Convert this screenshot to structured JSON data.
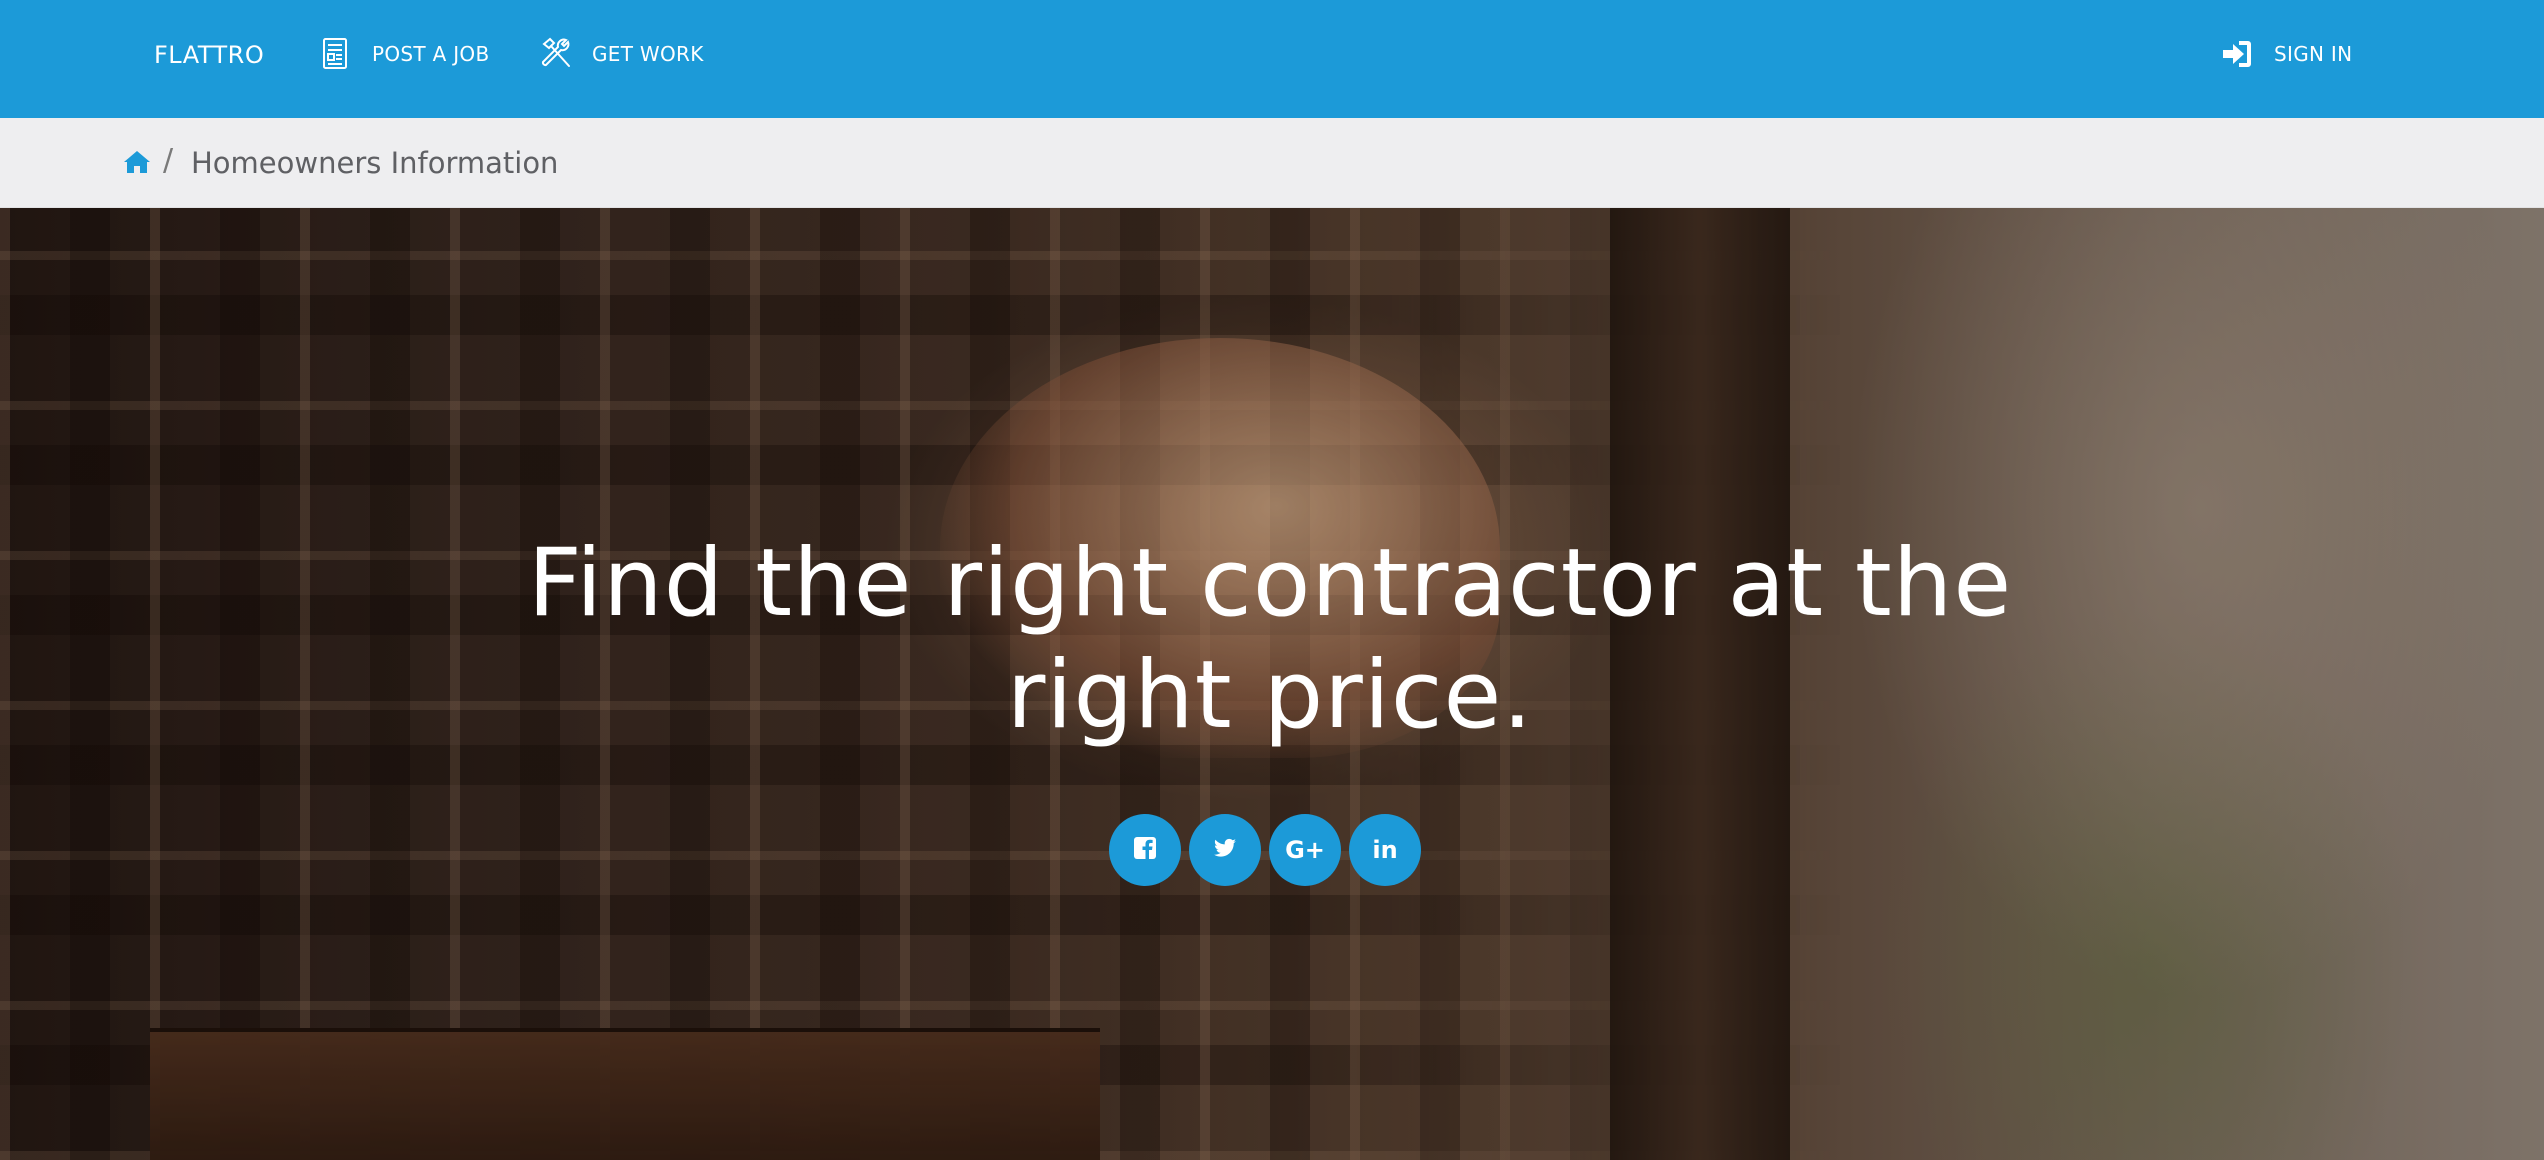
{
  "navbar": {
    "brand": "FLATTRO",
    "links": [
      {
        "label": "POST A JOB",
        "icon": "job-post-icon"
      },
      {
        "label": "GET WORK",
        "icon": "tools-icon"
      }
    ],
    "signin": {
      "label": "SIGN IN",
      "icon": "sign-in-icon"
    },
    "background_color": "#1c9ad8"
  },
  "breadcrumb": {
    "home_icon": "home-icon",
    "separator": "/",
    "current": "Homeowners Information"
  },
  "hero": {
    "title": "Find the right contractor at the right price.",
    "social": [
      {
        "name": "facebook",
        "icon": "facebook-icon"
      },
      {
        "name": "twitter",
        "icon": "twitter-icon"
      },
      {
        "name": "google-plus",
        "icon": "google-plus-icon",
        "glyph": "G+"
      },
      {
        "name": "linkedin",
        "icon": "linkedin-icon",
        "glyph": "in"
      }
    ],
    "accent_color": "#1c9ad8"
  }
}
